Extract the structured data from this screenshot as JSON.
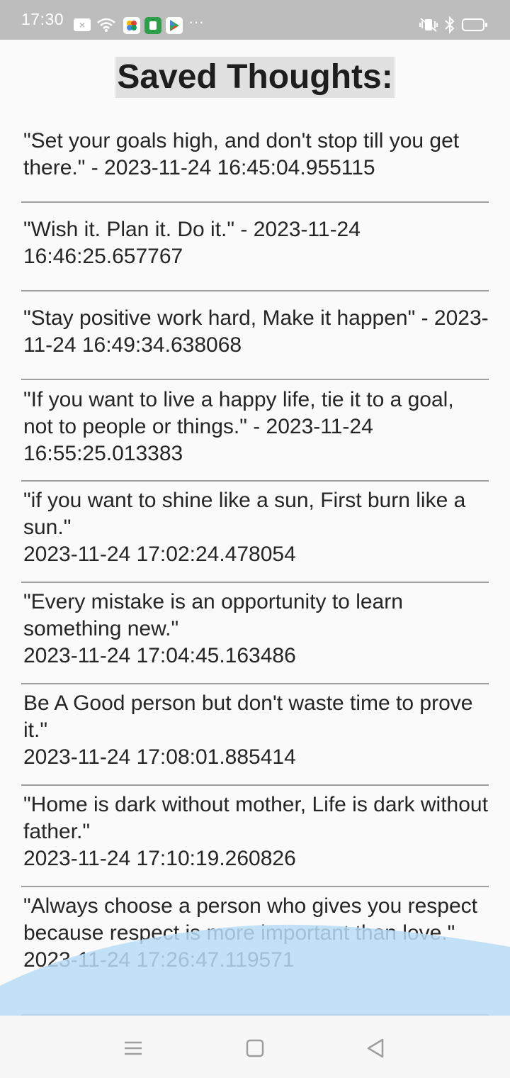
{
  "status_bar": {
    "time": "17:30",
    "icons": [
      "sim-x-icon",
      "wifi-icon",
      "app-photos-icon",
      "app-store-icon",
      "play-store-icon",
      "more-icon",
      "vibrate-icon",
      "bluetooth-icon",
      "battery-icon"
    ],
    "more": "···"
  },
  "page": {
    "title": "Saved Thoughts:"
  },
  "thoughts": [
    {
      "text": "\"Set your goals high, and don't stop till you get there.\" - 2023-11-24 16:45:04.955115"
    },
    {
      "text": "\"Wish it. Plan it. Do it.\" - 2023-11-24 16:46:25.657767"
    },
    {
      "text": "\"Stay positive work hard, Make it happen\" - 2023-11-24 16:49:34.638068"
    },
    {
      "text": "\"If you want to live a happy life, tie it to a goal, not to people or things.\" - 2023-11-24 16:55:25.013383"
    },
    {
      "text": "\"if you want to shine like a sun, First burn like a sun.\"\n2023-11-24 17:02:24.478054"
    },
    {
      "text": "\"Every mistake is an opportunity to learn something new.\"\n2023-11-24 17:04:45.163486"
    },
    {
      "text": "Be A Good person but don't waste time to prove it.\"\n2023-11-24 17:08:01.885414"
    },
    {
      "text": "\"Home is dark without mother, Life is dark without father.\"\n2023-11-24 17:10:19.260826"
    },
    {
      "text": "\"Always choose a person who gives you respect because respect is more important than love.\"\n2023-11-24 17:26:47.119571"
    }
  ],
  "nav_bar": {
    "icons": [
      "menu-icon",
      "home-icon",
      "back-icon"
    ]
  },
  "colors": {
    "status_bar_bg": "#bdbdbd",
    "title_highlight": "#e0e0e0",
    "wave": "#b9dcf5",
    "divider": "#9e9e9e"
  }
}
